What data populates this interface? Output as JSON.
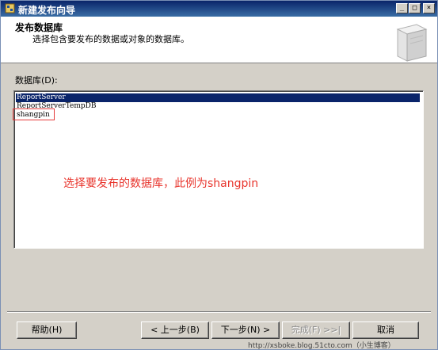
{
  "window": {
    "title": "新建发布向导",
    "controls": {
      "minimize": "_",
      "maximize": "□",
      "close": "×"
    }
  },
  "header": {
    "title": "发布数据库",
    "subtitle": "选择包含要发布的数据或对象的数据库。",
    "icon": "server-icon"
  },
  "database_list": {
    "label": "数据库(D):",
    "items": [
      {
        "name": "ReportServer",
        "selected": true
      },
      {
        "name": "ReportServerTempDB",
        "selected": false
      },
      {
        "name": "shangpin",
        "selected": false
      }
    ]
  },
  "annotation": {
    "text": "选择要发布的数据库，此例为shangpin",
    "color": "#e8342c"
  },
  "buttons": {
    "help": "帮助(H)",
    "back": "< 上一步(B)",
    "next": "下一步(N) >",
    "finish": "完成(F) >>|",
    "cancel": "取消"
  },
  "watermark": "http://xsboke.blog.51cto.com（小生博客）",
  "colors": {
    "titlebar": "#0a246a",
    "selection": "#0a246a",
    "annotation": "#e8342c",
    "dialog_bg": "#d4d0c8"
  }
}
